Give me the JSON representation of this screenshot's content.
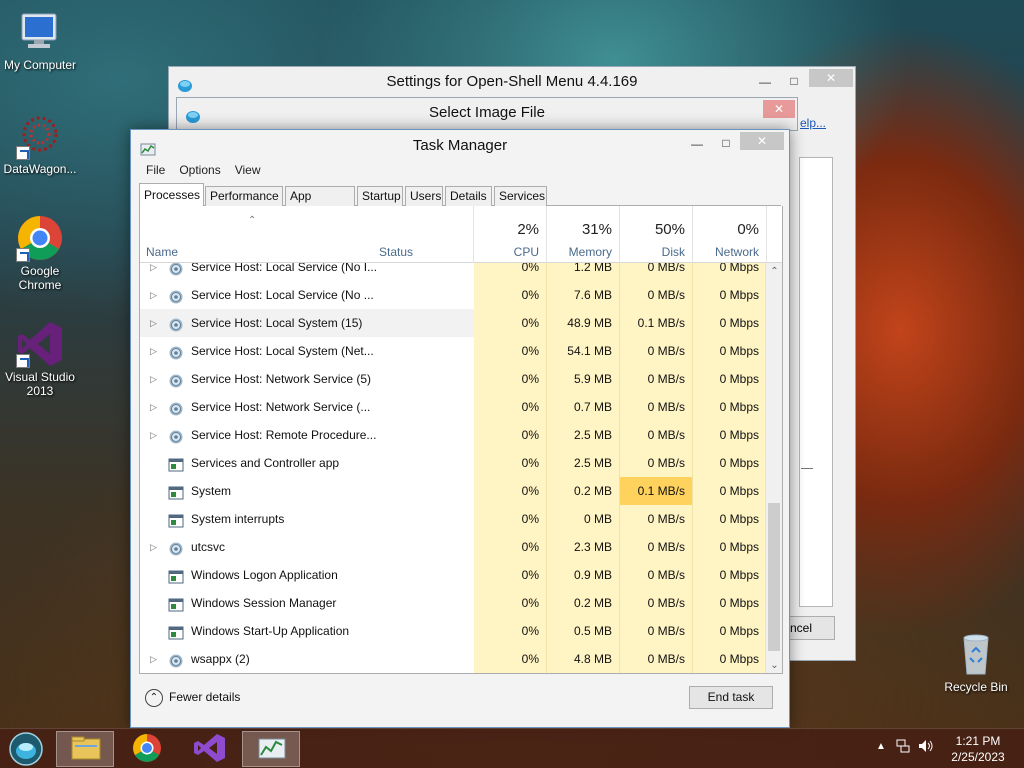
{
  "desktop": {
    "icons": [
      {
        "label": "My Computer"
      },
      {
        "label": "DataWagon..."
      },
      {
        "label": "Google Chrome"
      },
      {
        "label": "Visual Studio 2013"
      },
      {
        "label": "Recycle Bin"
      }
    ]
  },
  "bg_windows": {
    "openshell_title": "Settings for Open-Shell Menu 4.4.169",
    "select_image_title": "Select Image File",
    "help_fragment": "elp...",
    "cancel_fragment": "ncel"
  },
  "taskmgr": {
    "title": "Task Manager",
    "menu": [
      "File",
      "Options",
      "View"
    ],
    "tabs": [
      "Processes",
      "Performance",
      "App history",
      "Startup",
      "Users",
      "Details",
      "Services"
    ],
    "active_tab": "Processes",
    "columns": {
      "name": "Name",
      "status": "Status",
      "cpu": {
        "pct": "2%",
        "label": "CPU"
      },
      "memory": {
        "pct": "31%",
        "label": "Memory"
      },
      "disk": {
        "pct": "50%",
        "label": "Disk"
      },
      "network": {
        "pct": "0%",
        "label": "Network"
      }
    },
    "rows": [
      {
        "name": "Service Host: Local Service (No I...",
        "cpu": "0%",
        "memory": "1.2 MB",
        "disk": "0 MB/s",
        "network": "0 Mbps",
        "expandable": true,
        "icon": "gear-icon"
      },
      {
        "name": "Service Host: Local Service (No ...",
        "cpu": "0%",
        "memory": "7.6 MB",
        "disk": "0 MB/s",
        "network": "0 Mbps",
        "expandable": true,
        "icon": "gear-icon"
      },
      {
        "name": "Service Host: Local System (15)",
        "cpu": "0%",
        "memory": "48.9 MB",
        "disk": "0.1 MB/s",
        "network": "0 Mbps",
        "expandable": true,
        "icon": "gear-icon",
        "selected": true
      },
      {
        "name": "Service Host: Local System (Net...",
        "cpu": "0%",
        "memory": "54.1 MB",
        "disk": "0 MB/s",
        "network": "0 Mbps",
        "expandable": true,
        "icon": "gear-icon"
      },
      {
        "name": "Service Host: Network Service (5)",
        "cpu": "0%",
        "memory": "5.9 MB",
        "disk": "0 MB/s",
        "network": "0 Mbps",
        "expandable": true,
        "icon": "gear-icon"
      },
      {
        "name": "Service Host: Network Service (...",
        "cpu": "0%",
        "memory": "0.7 MB",
        "disk": "0 MB/s",
        "network": "0 Mbps",
        "expandable": true,
        "icon": "gear-icon"
      },
      {
        "name": "Service Host: Remote Procedure...",
        "cpu": "0%",
        "memory": "2.5 MB",
        "disk": "0 MB/s",
        "network": "0 Mbps",
        "expandable": true,
        "icon": "gear-icon"
      },
      {
        "name": "Services and Controller app",
        "cpu": "0%",
        "memory": "2.5 MB",
        "disk": "0 MB/s",
        "network": "0 Mbps",
        "expandable": false,
        "icon": "app-window-icon"
      },
      {
        "name": "System",
        "cpu": "0%",
        "memory": "0.2 MB",
        "disk": "0.1 MB/s",
        "network": "0 Mbps",
        "expandable": false,
        "icon": "app-window-icon",
        "disk_highlight": true
      },
      {
        "name": "System interrupts",
        "cpu": "0%",
        "memory": "0 MB",
        "disk": "0 MB/s",
        "network": "0 Mbps",
        "expandable": false,
        "icon": "app-window-icon"
      },
      {
        "name": "utcsvc",
        "cpu": "0%",
        "memory": "2.3 MB",
        "disk": "0 MB/s",
        "network": "0 Mbps",
        "expandable": true,
        "icon": "gear-icon"
      },
      {
        "name": "Windows Logon Application",
        "cpu": "0%",
        "memory": "0.9 MB",
        "disk": "0 MB/s",
        "network": "0 Mbps",
        "expandable": false,
        "icon": "app-window-icon"
      },
      {
        "name": "Windows Session Manager",
        "cpu": "0%",
        "memory": "0.2 MB",
        "disk": "0 MB/s",
        "network": "0 Mbps",
        "expandable": false,
        "icon": "app-window-icon"
      },
      {
        "name": "Windows Start-Up Application",
        "cpu": "0%",
        "memory": "0.5 MB",
        "disk": "0 MB/s",
        "network": "0 Mbps",
        "expandable": false,
        "icon": "app-window-icon"
      },
      {
        "name": "wsappx (2)",
        "cpu": "0%",
        "memory": "4.8 MB",
        "disk": "0 MB/s",
        "network": "0 Mbps",
        "expandable": true,
        "icon": "gear-icon"
      }
    ],
    "footer": {
      "fewer_details": "Fewer details",
      "end_task": "End task"
    }
  },
  "taskbar": {
    "time": "1:21 PM",
    "date": "2/25/2023"
  },
  "colors": {
    "usage_light": "#fff4c4",
    "usage_strong": "#ffd25e",
    "selection": "#f2f2f2",
    "title_accent": "#6a95c2",
    "close_red": "#e04343"
  }
}
